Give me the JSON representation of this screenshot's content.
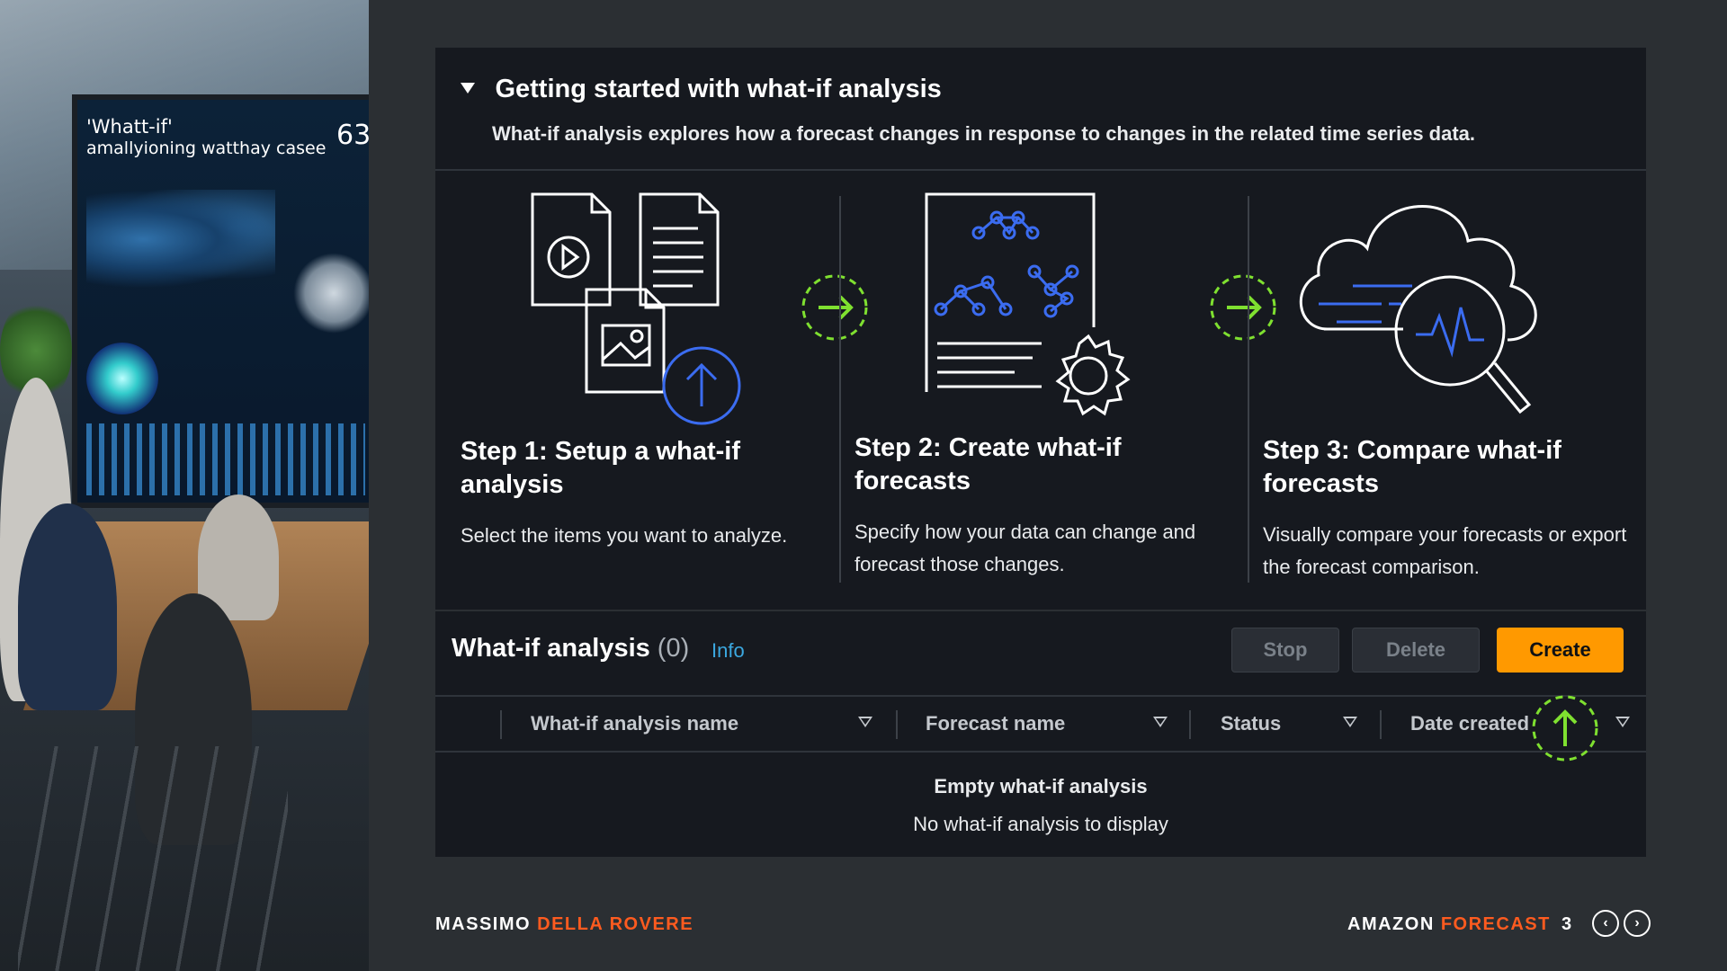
{
  "header": {
    "title": "Getting started with what-if analysis",
    "description": "What-if analysis explores how a forecast changes in response to changes in the related time series data."
  },
  "steps": [
    {
      "title": "Step 1: Setup a what-if analysis",
      "description": "Select the items you want to analyze."
    },
    {
      "title": "Step 2: Create what-if forecasts",
      "description": "Specify how your data can change and forecast those changes."
    },
    {
      "title": "Step 3: Compare what-if forecasts",
      "description": "Visually compare your forecasts or export the forecast comparison."
    }
  ],
  "table": {
    "title": "What-if analysis",
    "count": "(0)",
    "info_label": "Info",
    "buttons": {
      "stop": "Stop",
      "delete": "Delete",
      "create": "Create"
    },
    "columns": [
      "What-if analysis name",
      "Forecast name",
      "Status",
      "Date created"
    ],
    "empty_title": "Empty what-if analysis",
    "empty_text": "No what-if analysis to display"
  },
  "photo": {
    "screen_title_line1": "'Whatt-if'",
    "screen_title_line2": "amallyioning watthay casee",
    "screen_number": "63"
  },
  "footer": {
    "author_first": "MASSIMO",
    "author_last": "DELLA ROVERE",
    "brand_first": "AMAZON",
    "brand_last": "FORECAST",
    "page": "3"
  },
  "colors": {
    "accent_orange": "#ff9900",
    "footer_accent": "#ff5b1f",
    "info_link": "#3ba8e0",
    "annotation_green": "#7fe030",
    "icon_blue": "#3b6cf0"
  },
  "icons": [
    "documents-upload-icon",
    "arrow-right-icon",
    "forecast-graph-gear-icon",
    "cloud-compare-magnifier-icon",
    "sort-ascending-annotation-icon"
  ]
}
